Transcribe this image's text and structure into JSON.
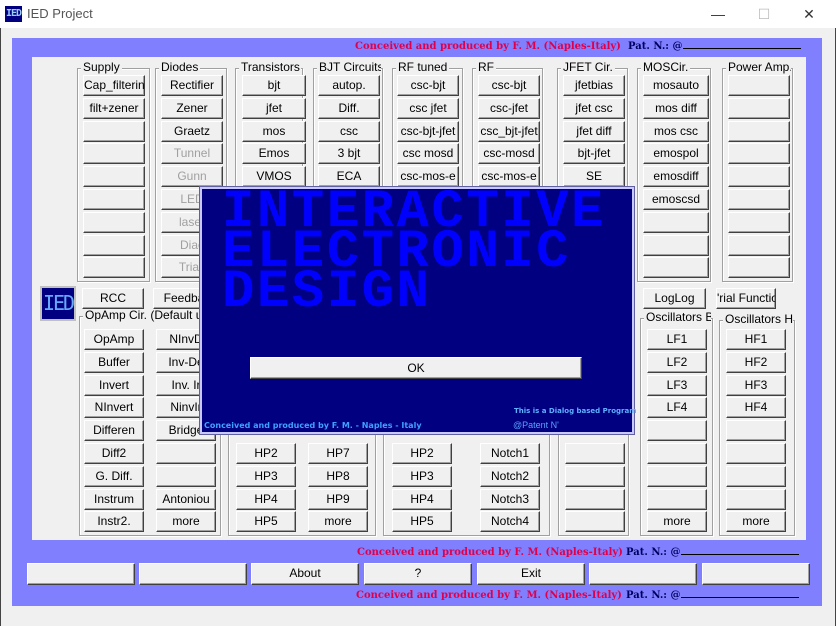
{
  "window": {
    "title": "IED Project",
    "app_icon": "IED",
    "minimize": "—",
    "maximize": "☐",
    "close": "✕"
  },
  "credit": {
    "text": "Conceived and produced by F. M. (Naples-Italy)",
    "patent": "Pat. N.: @"
  },
  "logo": "IED",
  "top_groups": [
    {
      "label": "Supply",
      "buttons": [
        "Cap_filtering",
        "filt+zener",
        "",
        "",
        "",
        "",
        "",
        "",
        ""
      ]
    },
    {
      "label": "Diodes",
      "buttons": [
        "Rectifier",
        "Zener",
        "Graetz",
        "Tunnel",
        "Gunn",
        "LED",
        "laser",
        "Diac",
        "Triac"
      ],
      "disabled_from": 3
    },
    {
      "label": "Transistors",
      "buttons": [
        "bjt",
        "jfet",
        "mos",
        "Emos",
        "VMOS"
      ]
    },
    {
      "label": "BJT Circuits.",
      "buttons": [
        "autop.",
        "Diff.",
        "csc",
        "3 bjt",
        "ECA"
      ]
    },
    {
      "label": "RF tuned",
      "buttons": [
        "csc-bjt",
        "csc jfet",
        "csc-bjt-jfet",
        "csc mosd",
        "csc-mos-e"
      ]
    },
    {
      "label": "RF",
      "buttons": [
        "csc-bjt",
        "csc-jfet",
        "csc_bjt-jfet",
        "csc-mosd",
        "csc-mos-e"
      ]
    },
    {
      "label": "JFET Cir.",
      "buttons": [
        "jfetbias",
        "jfet csc",
        "jfet diff",
        "bjt-jfet",
        "SE"
      ]
    },
    {
      "label": "MOSCir.",
      "buttons": [
        "mosauto",
        "mos diff",
        "mos csc",
        "emospol",
        "emosdiff",
        "emoscsd",
        "",
        "",
        ""
      ]
    },
    {
      "label": "Power Amp.",
      "buttons": [
        "",
        "",
        "",
        "",
        "",
        "",
        "",
        "",
        ""
      ]
    }
  ],
  "middle_buttons": [
    "RCC",
    "Feedba",
    "LogLog",
    "'rial Functio"
  ],
  "opamp_group": {
    "label": "OpAmp Cir. (Default uA",
    "col1": [
      "OpAmp",
      "Buffer",
      "Invert",
      "NInvert",
      "Differen",
      "Diff2",
      "G. Diff.",
      "Instrum",
      "Instr2."
    ],
    "col2": [
      "NInvD",
      "Inv-De",
      "Inv. Ir",
      "NinvIr",
      "Bridge",
      "",
      "",
      "Antoniou",
      "more"
    ]
  },
  "filter_group": {
    "col1": [
      "HP2",
      "HP3",
      "HP4",
      "HP5"
    ],
    "col2": [
      "HP7",
      "HP8",
      "HP9",
      "more"
    ]
  },
  "filter_group2": {
    "col1": [
      "HP2",
      "HP3",
      "HP4",
      "HP5"
    ],
    "col2": [
      "Notch1",
      "Notch2",
      "Notch3",
      "Notch4"
    ]
  },
  "blank_group": {
    "buttons": [
      "",
      "",
      "",
      ""
    ]
  },
  "osc_bf": {
    "label": "Oscillators BF",
    "buttons": [
      "LF1",
      "LF2",
      "LF3",
      "LF4",
      "",
      "",
      "",
      "",
      "more"
    ]
  },
  "osc_hf": {
    "label": "Oscillators HF",
    "buttons": [
      "HF1",
      "HF2",
      "HF3",
      "HF4",
      "",
      "",
      "",
      "",
      "more"
    ]
  },
  "bottom_buttons": [
    "",
    "",
    "About",
    "?",
    "Exit",
    "",
    ""
  ],
  "dialog": {
    "title_lines": "INTERACTIVE\nELECTRONIC\nDESIGN",
    "ok": "OK",
    "footer": "Conceived and produced by F. M. - Naples - Italy",
    "note": "This is a Dialog based Program",
    "patent": "@Patent N'"
  }
}
